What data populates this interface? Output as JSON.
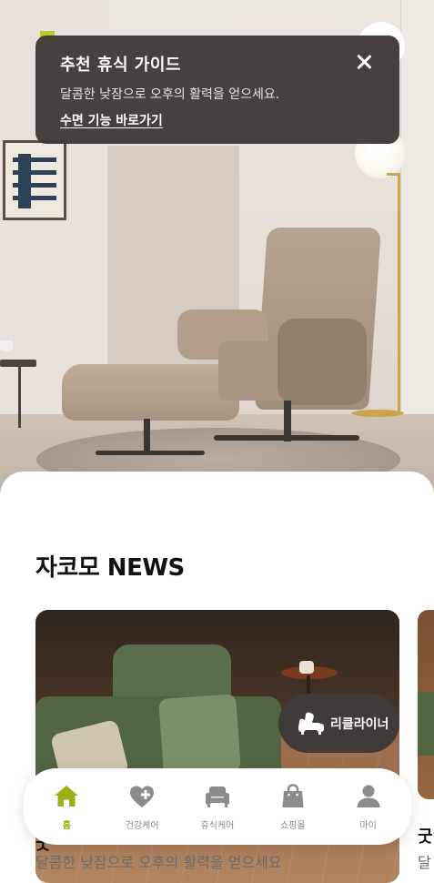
{
  "tooltip": {
    "title": "추천 휴식 가이드",
    "description": "달콤한 낮잠으로 오후의 활력을 얻으세요.",
    "link_label": "수면 기능 바로가기"
  },
  "news": {
    "section_title": "자코모 NEWS",
    "cards": [
      {
        "title": "굿",
        "caption": "달콤한 낮잠으로 오후의 활력을 얻으세요"
      },
      {
        "title": "굿",
        "caption": "달"
      }
    ]
  },
  "fab": {
    "label": "리클라이너",
    "icon": "recliner-icon"
  },
  "bottom_nav": {
    "items": [
      {
        "label": "홈",
        "icon": "home-icon",
        "active": true
      },
      {
        "label": "건강케어",
        "icon": "heart-plus-icon",
        "active": false
      },
      {
        "label": "휴식케어",
        "icon": "sofa-icon",
        "active": false
      },
      {
        "label": "쇼핑몰",
        "icon": "shopping-bag-icon",
        "active": false
      },
      {
        "label": "마이",
        "icon": "person-icon",
        "active": false
      }
    ]
  },
  "colors": {
    "accent": "#9bb017",
    "tooltip_bg": "#3e3937",
    "inactive_icon": "#8c8c8c",
    "fab_bg": "#3f3b39"
  }
}
